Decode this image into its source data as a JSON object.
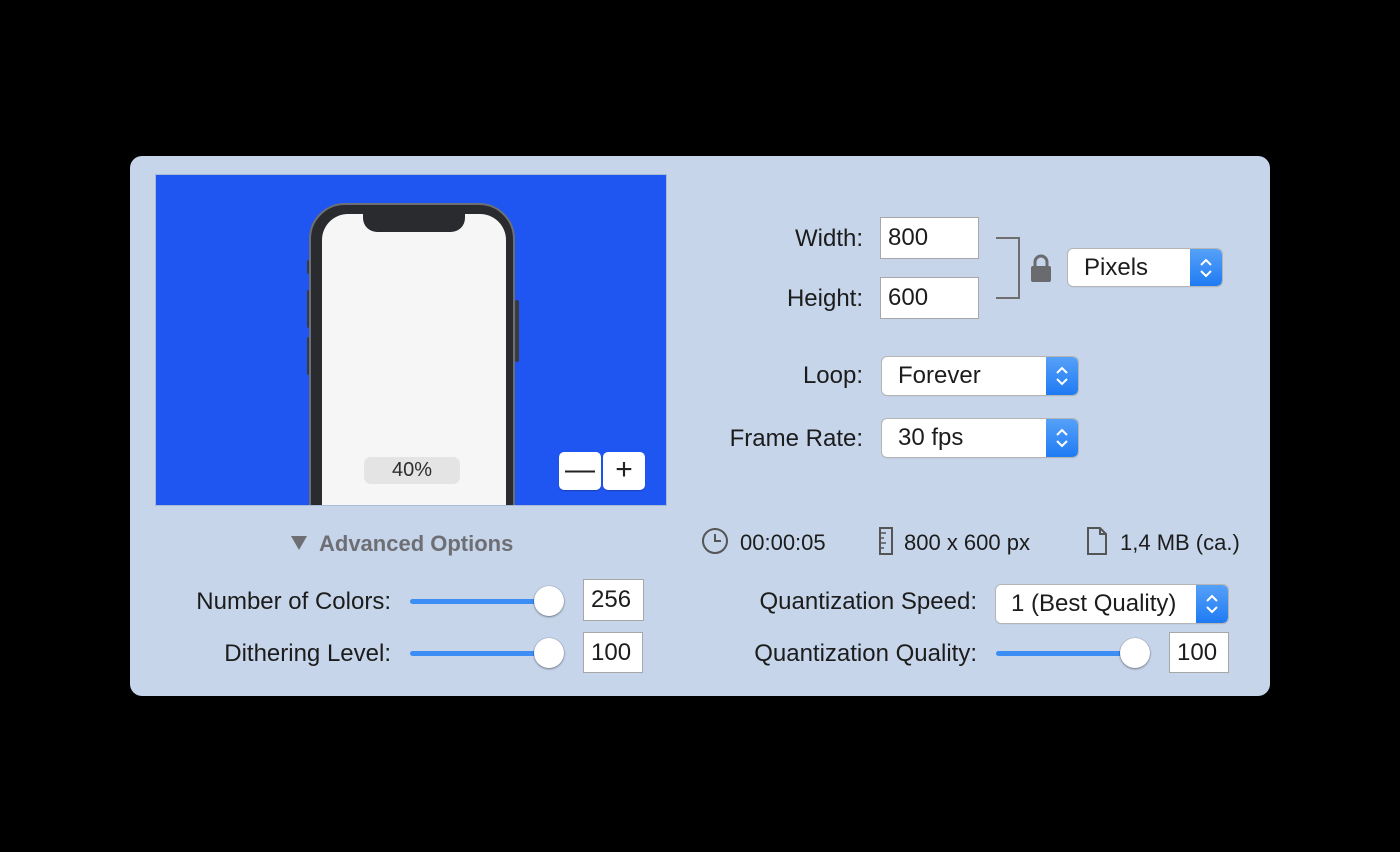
{
  "preview": {
    "zoom_label": "40%",
    "zoom_out_symbol": "—",
    "zoom_in_symbol": "+",
    "background_color": "#1f55f0"
  },
  "size": {
    "width_label": "Width:",
    "width_value": "800",
    "height_label": "Height:",
    "height_value": "600",
    "lock_icon": "lock-icon",
    "unit_selected": "Pixels"
  },
  "loop": {
    "label": "Loop:",
    "selected": "Forever"
  },
  "frame_rate": {
    "label": "Frame Rate:",
    "selected": "30 fps"
  },
  "info": {
    "duration": "00:00:05",
    "dimensions": "800 x 600 px",
    "file_size": "1,4 MB (ca.)"
  },
  "advanced": {
    "label": "Advanced Options"
  },
  "colors": {
    "label": "Number of Colors:",
    "value": "256",
    "slider_fraction": 1.0
  },
  "dithering": {
    "label": "Dithering Level:",
    "value": "100",
    "slider_fraction": 1.0
  },
  "quant_speed": {
    "label": "Quantization Speed:",
    "selected": "1 (Best Quality)"
  },
  "quant_quality": {
    "label": "Quantization Quality:",
    "value": "100",
    "slider_fraction": 1.0
  },
  "colors_theme": {
    "accent": "#3c8ef5",
    "panel": "#c6d5ea"
  }
}
